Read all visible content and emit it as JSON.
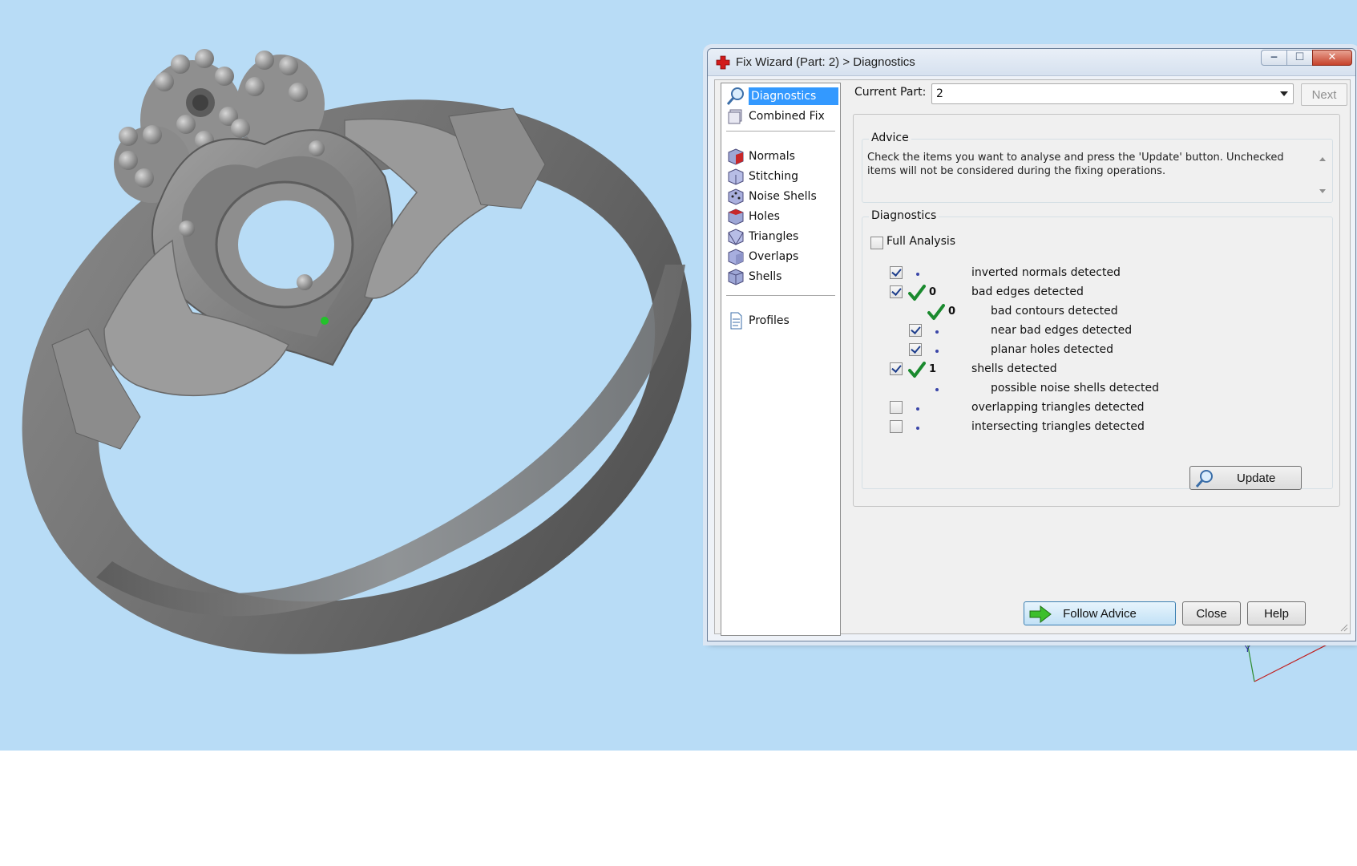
{
  "window": {
    "title": "Fix Wizard (Part: 2) > Diagnostics",
    "buttons": {
      "minimize": "minimize",
      "maximize": "maximize",
      "close": "close"
    }
  },
  "sidebar": {
    "items": [
      {
        "label": "Diagnostics",
        "icon": "magnifier-icon",
        "active": true
      },
      {
        "label": "Combined Fix",
        "icon": "cube-stack-icon"
      },
      {
        "label": "Normals",
        "icon": "red-cube-icon"
      },
      {
        "label": "Stitching",
        "icon": "stitch-cube-icon"
      },
      {
        "label": "Noise Shells",
        "icon": "dotted-cube-icon"
      },
      {
        "label": "Holes",
        "icon": "red-cube-icon"
      },
      {
        "label": "Triangles",
        "icon": "triangle-cube-icon"
      },
      {
        "label": "Overlaps",
        "icon": "overlap-cube-icon"
      },
      {
        "label": "Shells",
        "icon": "shell-cube-icon"
      },
      {
        "label": "Profiles",
        "icon": "document-icon"
      }
    ]
  },
  "current_part": {
    "label": "Current Part:",
    "value": "2"
  },
  "next_label": "Next",
  "advice": {
    "title": "Advice",
    "text": "Check the items you want to analyse and press the 'Update' button. Unchecked items will not be considered during the fixing operations."
  },
  "diagnostics": {
    "title": "Diagnostics",
    "full_analysis": {
      "label": "Full Analysis",
      "checked": false
    },
    "rows": [
      {
        "label": "inverted normals detected",
        "checked": true,
        "value": "",
        "ok": false,
        "indent": 0
      },
      {
        "label": "bad edges detected",
        "checked": true,
        "value": "0",
        "ok": true,
        "indent": 0
      },
      {
        "label": "bad contours detected",
        "checked": null,
        "value": "0",
        "ok": true,
        "indent": 1
      },
      {
        "label": "near bad edges detected",
        "checked": true,
        "value": "",
        "ok": false,
        "indent": 1
      },
      {
        "label": "planar holes detected",
        "checked": true,
        "value": "",
        "ok": false,
        "indent": 1
      },
      {
        "label": "shells detected",
        "checked": true,
        "value": "1",
        "ok": true,
        "indent": 0
      },
      {
        "label": "possible noise shells detected",
        "checked": null,
        "value": "",
        "ok": false,
        "indent": 1
      },
      {
        "label": "overlapping triangles detected",
        "checked": false,
        "value": "",
        "ok": false,
        "indent": 0
      },
      {
        "label": "intersecting triangles detected",
        "checked": false,
        "value": "",
        "ok": false,
        "indent": 0
      }
    ],
    "update_label": "Update"
  },
  "footer": {
    "follow_advice": "Follow Advice",
    "close": "Close",
    "help": "Help"
  },
  "colors": {
    "viewport_bg": "#b8dcf6",
    "selection": "#3399ff",
    "check_green": "#1a8a2e"
  }
}
